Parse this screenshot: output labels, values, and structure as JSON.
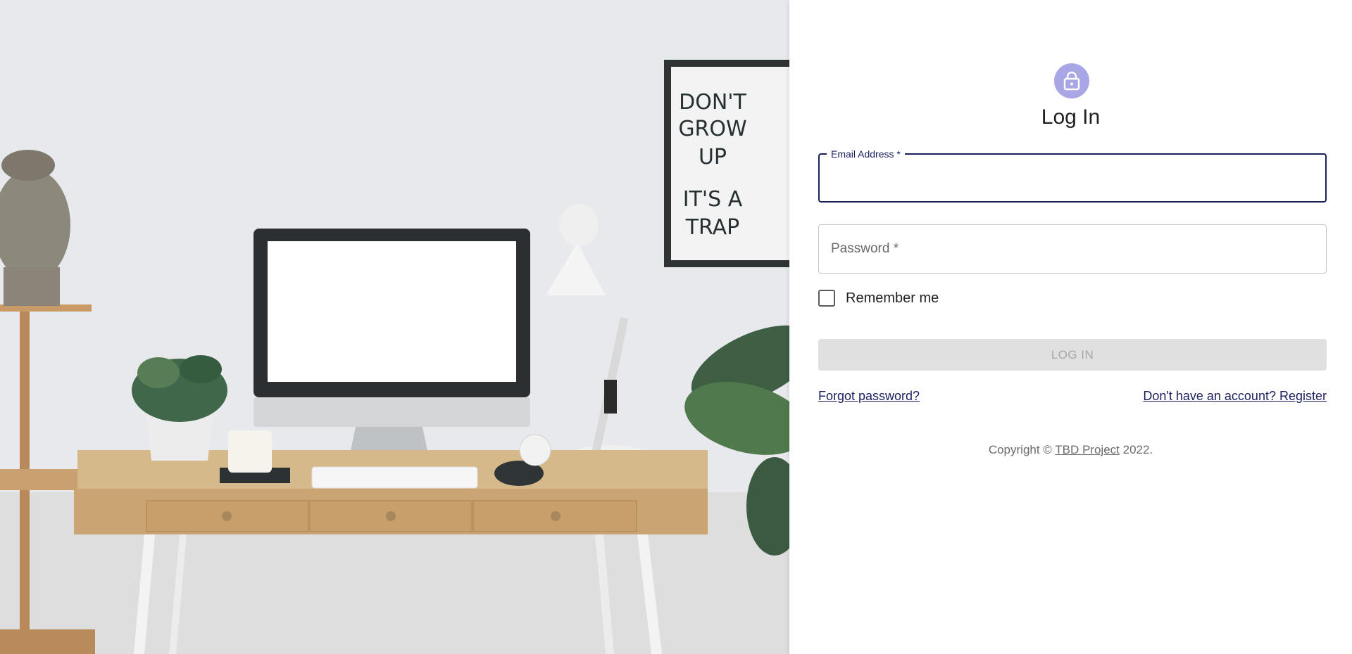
{
  "hero": {
    "poster_text": [
      "DON'T",
      "GROW",
      "UP",
      "IT'S A",
      "TRAP"
    ]
  },
  "login": {
    "title": "Log In",
    "email": {
      "label": "Email Address *",
      "value": "",
      "placeholder": ""
    },
    "password": {
      "label": "Password *",
      "value": ""
    },
    "remember_label": "Remember me",
    "remember_checked": false,
    "submit_label": "LOG IN",
    "forgot_link": "Forgot password?",
    "register_link": "Don't have an account? Register"
  },
  "footer": {
    "prefix": "Copyright © ",
    "brand": "TBD Project",
    "suffix": " 2022."
  },
  "colors": {
    "accent": "#1b1f5e",
    "avatar_bg": "#a9a6e6",
    "button_disabled_bg": "#e0e0e0",
    "button_disabled_text": "#a7a7a7"
  },
  "icons": {
    "avatar": "lock-icon"
  }
}
